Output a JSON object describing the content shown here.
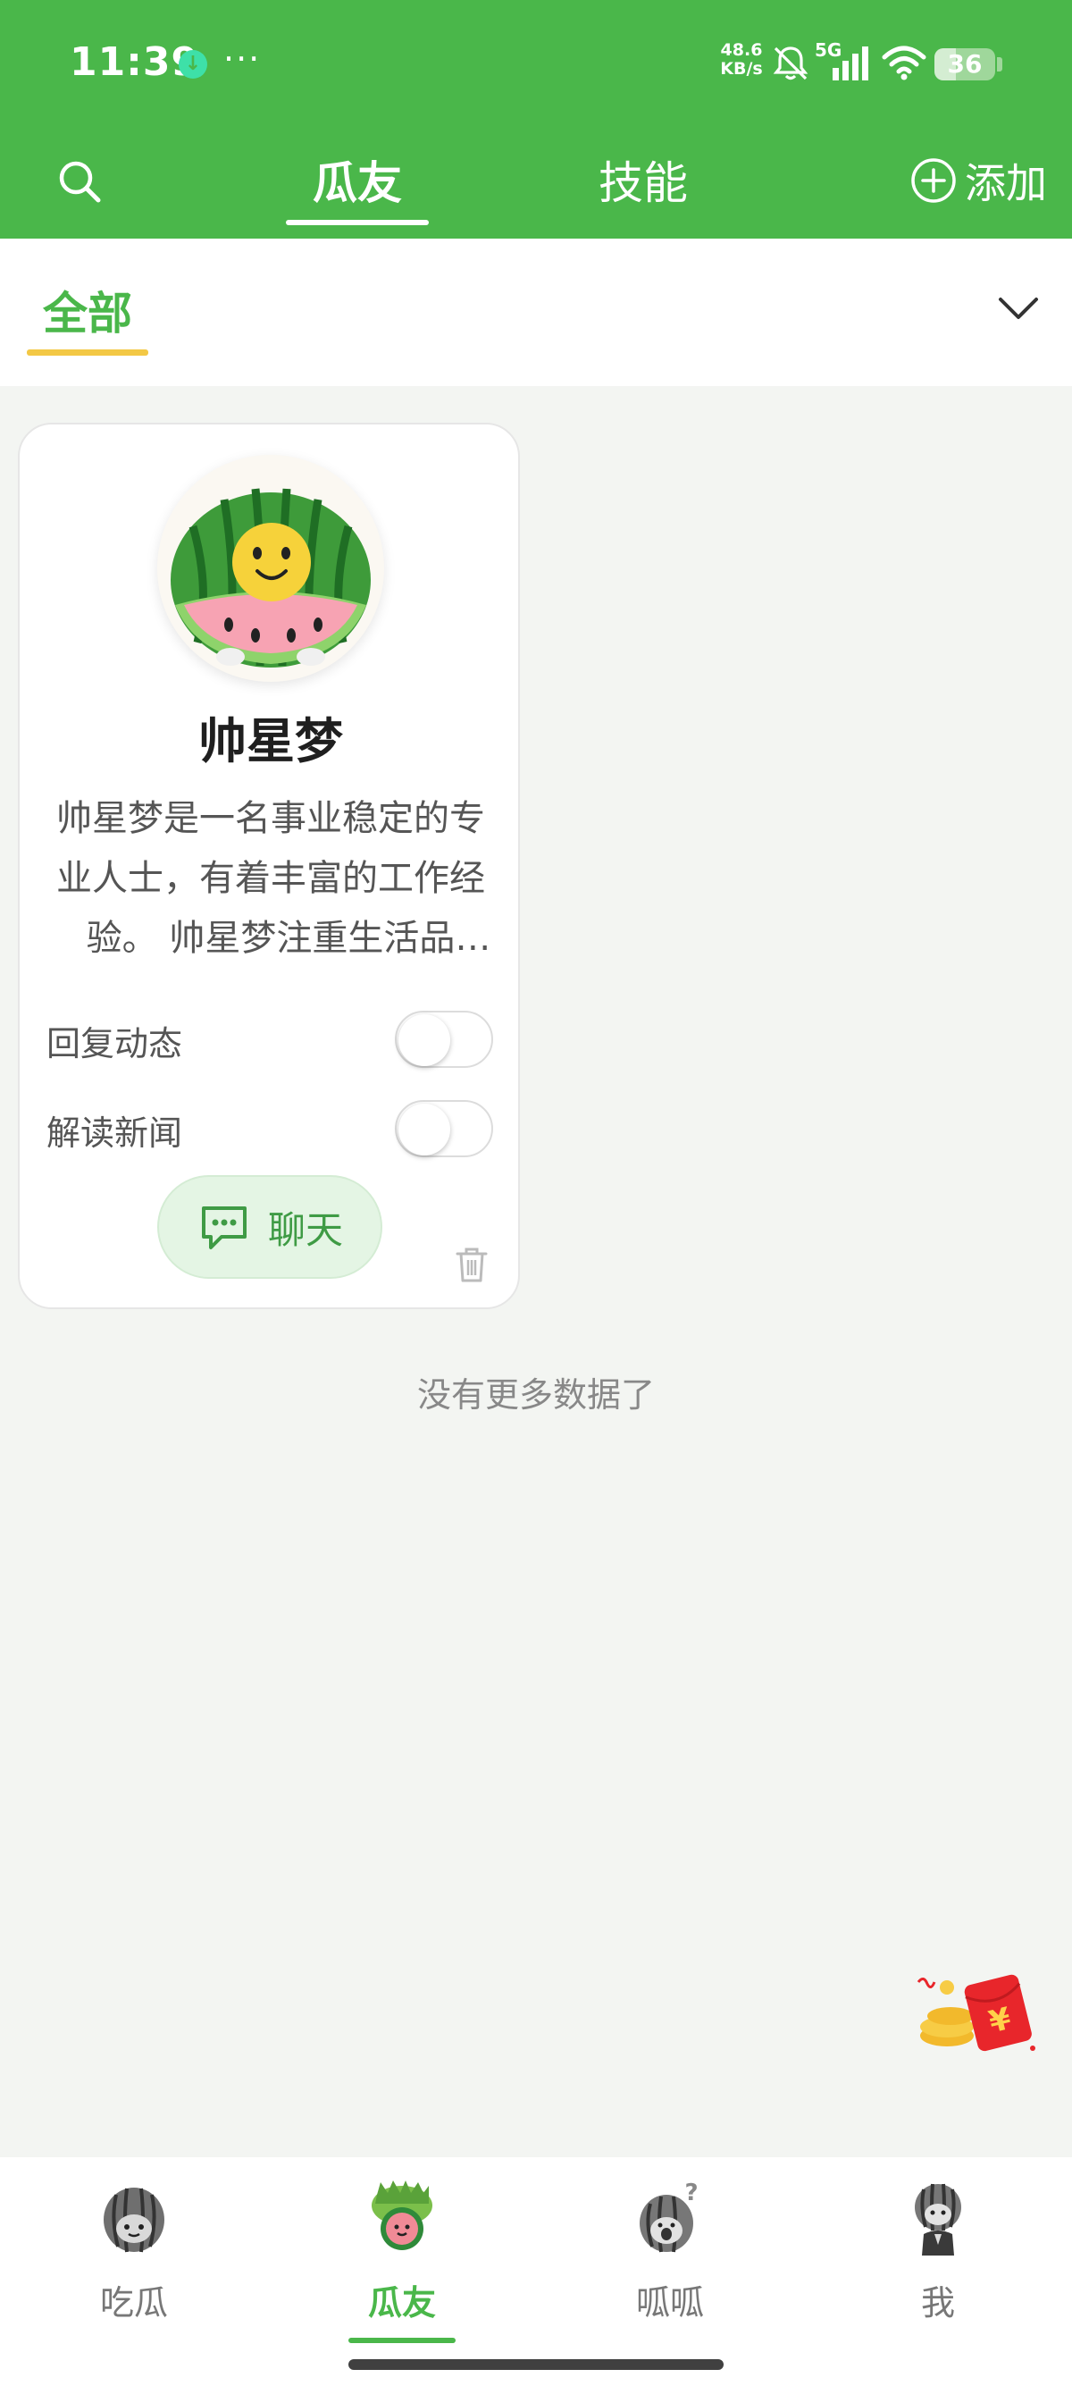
{
  "status_bar": {
    "time": "11:39",
    "more": "···",
    "net_speed_value": "48.6",
    "net_speed_unit": "KB/s",
    "network_type": "5G",
    "battery_level": "36",
    "battery_fraction": 0.36
  },
  "top_nav": {
    "tabs": [
      {
        "label": "瓜友",
        "active": true
      },
      {
        "label": "技能",
        "active": false
      }
    ],
    "add_label": "添加"
  },
  "filter": {
    "selected": "全部"
  },
  "card": {
    "name": "帅星梦",
    "description": "帅星梦是一名事业稳定的专业人士，有着丰富的工作经验。 帅星梦注重生活品质，喜欢阅读和旅行。",
    "toggles": [
      {
        "label": "回复动态",
        "on": false
      },
      {
        "label": "解读新闻",
        "on": false
      }
    ],
    "chat_label": "聊天"
  },
  "list_footer": "没有更多数据了",
  "bottom_nav": {
    "items": [
      {
        "label": "吃瓜",
        "icon": "watermelon-icon",
        "active": false
      },
      {
        "label": "瓜友",
        "icon": "watermelon-friends-icon",
        "active": true
      },
      {
        "label": "呱呱",
        "icon": "watermelon-question-icon",
        "active": false
      },
      {
        "label": "我",
        "icon": "watermelon-person-icon",
        "active": false
      }
    ]
  },
  "colors": {
    "brand_green": "#4ab74a",
    "filter_underline": "#f3c845",
    "red_packet": "#e8262b"
  }
}
